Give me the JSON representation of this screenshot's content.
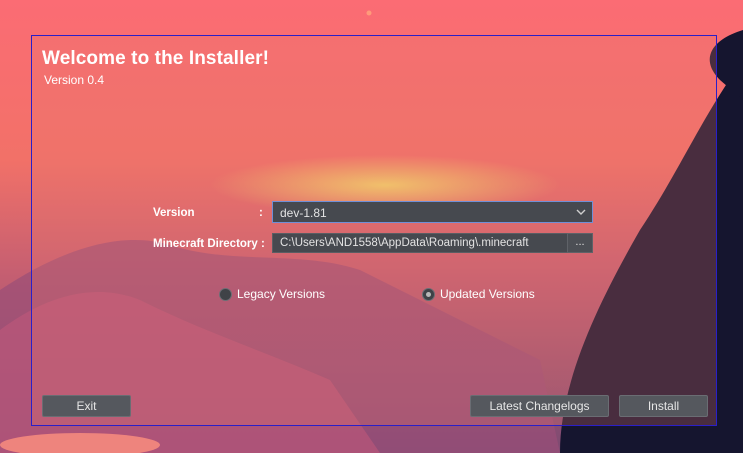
{
  "window": {
    "title": "Welcome to the Installer!",
    "version_text": "Version 0.4"
  },
  "form": {
    "version_label": "Version",
    "version_colon": ":",
    "version_value": "dev-1.81",
    "directory_label": "Minecraft Directory :",
    "directory_value": "C:\\Users\\AND1558\\AppData\\Roaming\\.minecraft",
    "browse_label": "..."
  },
  "radios": {
    "legacy_label": "Legacy Versions",
    "updated_label": "Updated Versions",
    "selected": "updated"
  },
  "buttons": {
    "exit_label": "Exit",
    "changelogs_label": "Latest Changelogs",
    "install_label": "Install"
  },
  "colors": {
    "panel_border": "#2a1fc9",
    "field_bg": "#46494f",
    "button_bg": "#55585e",
    "text": "#ffffff"
  },
  "icons": {
    "dropdown": "chevron-down-icon"
  }
}
